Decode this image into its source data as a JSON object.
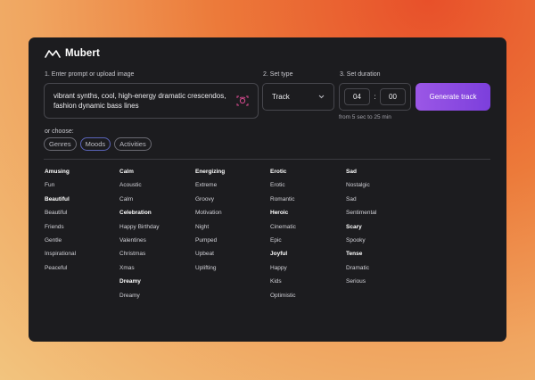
{
  "brand": {
    "name": "Mubert"
  },
  "steps": {
    "prompt_label": "1. Enter prompt or upload image",
    "type_label": "2. Set type",
    "duration_label": "3. Set duration"
  },
  "prompt": {
    "text": "vibrant synths, cool, high-energy dramatic crescendos, fashion dynamic bass lines"
  },
  "type": {
    "value": "Track"
  },
  "duration": {
    "minutes": "04",
    "seconds": "00",
    "separator": ":",
    "hint": "from 5 sec to 25 min"
  },
  "generate_label": "Generate track",
  "choose": {
    "label": "or choose:",
    "chips": [
      "Genres",
      "Moods",
      "Activities"
    ],
    "active": "Moods"
  },
  "categories": [
    {
      "items": [
        {
          "text": "Amusing",
          "head": true
        },
        {
          "text": "Fun"
        },
        {
          "text": "Beautiful",
          "head": true
        },
        {
          "text": "Beautiful"
        },
        {
          "text": "Friends"
        },
        {
          "text": "Gentle"
        },
        {
          "text": "Inspirational"
        },
        {
          "text": "Peaceful"
        }
      ]
    },
    {
      "items": [
        {
          "text": "Calm",
          "head": true
        },
        {
          "text": "Acoustic"
        },
        {
          "text": "Calm"
        },
        {
          "text": "Celebration",
          "head": true
        },
        {
          "text": "Happy Birthday"
        },
        {
          "text": "Valentines"
        },
        {
          "text": "Christmas"
        },
        {
          "text": "Xmas"
        },
        {
          "text": "Dreamy",
          "head": true
        },
        {
          "text": "Dreamy"
        }
      ]
    },
    {
      "items": [
        {
          "text": "Energizing",
          "head": true
        },
        {
          "text": "Extreme"
        },
        {
          "text": "Groovy"
        },
        {
          "text": "Motivation"
        },
        {
          "text": "Night"
        },
        {
          "text": "Pumped"
        },
        {
          "text": "Upbeat"
        },
        {
          "text": "Uplifting"
        }
      ]
    },
    {
      "items": [
        {
          "text": "Erotic",
          "head": true
        },
        {
          "text": "Erotic"
        },
        {
          "text": "Romantic"
        },
        {
          "text": "Heroic",
          "head": true
        },
        {
          "text": "Cinematic"
        },
        {
          "text": "Epic"
        },
        {
          "text": "Joyful",
          "head": true
        },
        {
          "text": "Happy"
        },
        {
          "text": "Kids"
        },
        {
          "text": "Optimistic"
        }
      ]
    },
    {
      "items": [
        {
          "text": "Sad",
          "head": true
        },
        {
          "text": "Nostalgic"
        },
        {
          "text": "Sad"
        },
        {
          "text": "Sentimental"
        },
        {
          "text": "Scary",
          "head": true
        },
        {
          "text": "Spooky"
        },
        {
          "text": "Tense",
          "head": true
        },
        {
          "text": "Dramatic"
        },
        {
          "text": "Serious"
        }
      ]
    }
  ],
  "colors": {
    "panel": "#1c1c1f",
    "accent": "#9b57e6",
    "active_chip": "#5a64b8",
    "camera_icon": "#d64a8f"
  }
}
